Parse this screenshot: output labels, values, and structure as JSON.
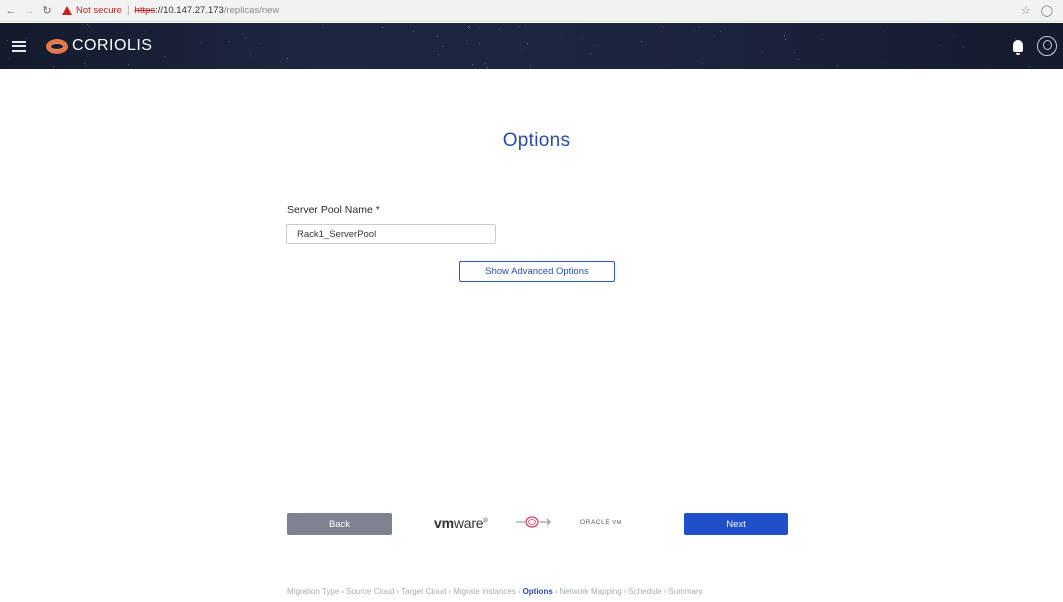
{
  "browser": {
    "security_warning": "Not secure",
    "url_scheme": "https",
    "url_host": "://10.147.27.173",
    "url_path": "/replicas/new",
    "back_icon": "arrow-left",
    "forward_icon": "arrow-right",
    "reload_icon": "reload",
    "star_icon": "star"
  },
  "header": {
    "logo_text": "CORIOLIS",
    "menu_icon": "hamburger",
    "notification_icon": "bell",
    "user_icon": "user-circle",
    "accent_color": "#e7774a"
  },
  "page": {
    "title": "Options"
  },
  "form": {
    "server_pool_label": "Server Pool Name *",
    "server_pool_value": "Rack1_ServerPool",
    "advanced_button": "Show Advanced Options"
  },
  "footer": {
    "back_label": "Back",
    "next_label": "Next",
    "source_logo_bold": "vm",
    "source_logo_rest": "ware",
    "target_logo": "ORACLE",
    "target_logo_suffix": "VM",
    "next_color": "#1f4fc9",
    "back_color": "#7e8290"
  },
  "steps": [
    {
      "label": "Migration Type",
      "active": false
    },
    {
      "label": "Source Cloud",
      "active": false
    },
    {
      "label": "Target Cloud",
      "active": false
    },
    {
      "label": "Migrate instances",
      "active": false
    },
    {
      "label": "Options",
      "active": true
    },
    {
      "label": "Network Mapping",
      "active": false
    },
    {
      "label": "Schedule",
      "active": false
    },
    {
      "label": "Summary",
      "active": false
    }
  ]
}
